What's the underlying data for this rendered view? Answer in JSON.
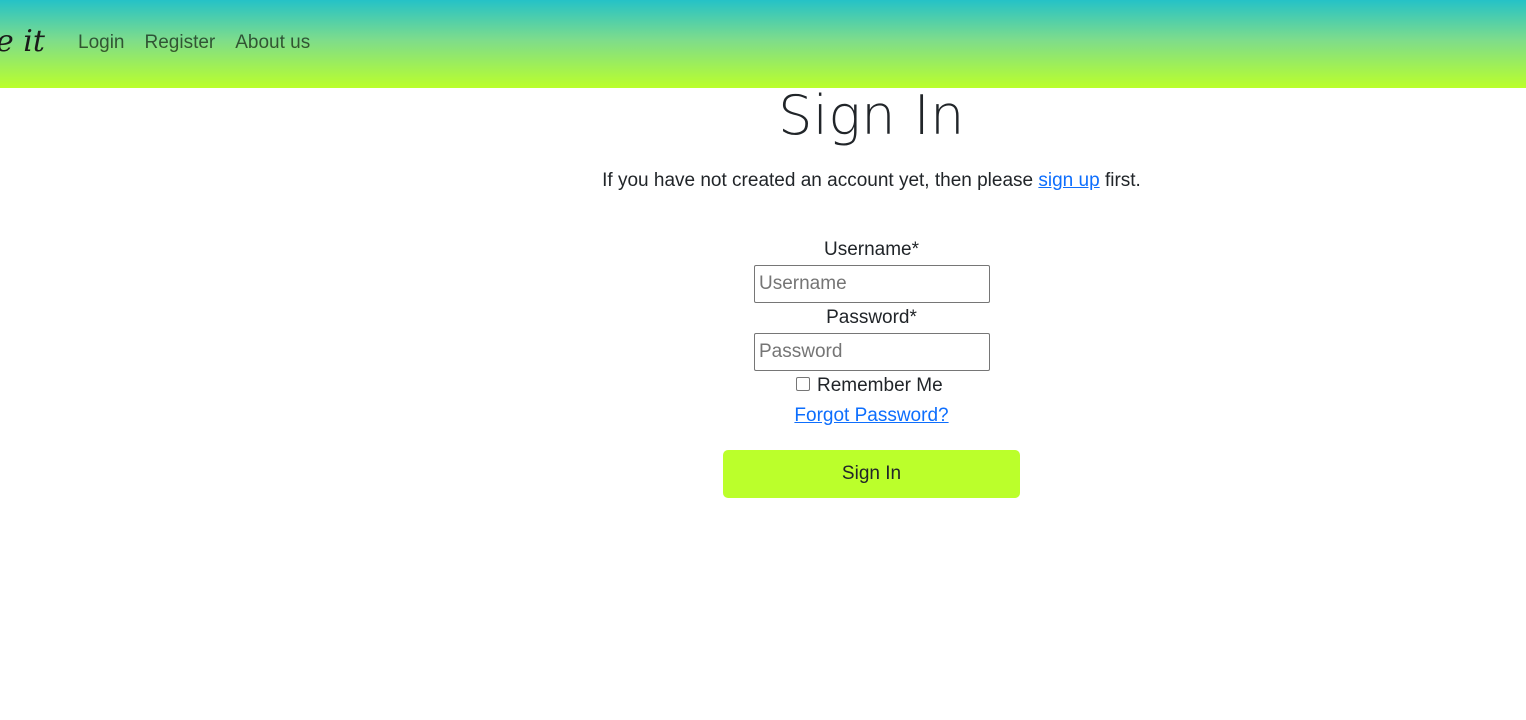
{
  "nav": {
    "brand": "e it",
    "links": [
      "Login",
      "Register",
      "About us"
    ]
  },
  "page": {
    "title": "Sign In",
    "intro_before": "If you have not created an account yet, then please ",
    "intro_link": "sign up",
    "intro_after": " first."
  },
  "form": {
    "username_label": "Username*",
    "username_placeholder": "Username",
    "username_value": "",
    "password_label": "Password*",
    "password_placeholder": "Password",
    "password_value": "",
    "remember_label": "Remember Me",
    "remember_checked": false,
    "forgot_link": "Forgot Password?",
    "submit_label": "Sign In"
  },
  "colors": {
    "header_gradient_top": "#25c2c7",
    "header_gradient_bottom": "#bbff2b",
    "button_bg": "#bbff2b",
    "link": "#0d6efd"
  }
}
